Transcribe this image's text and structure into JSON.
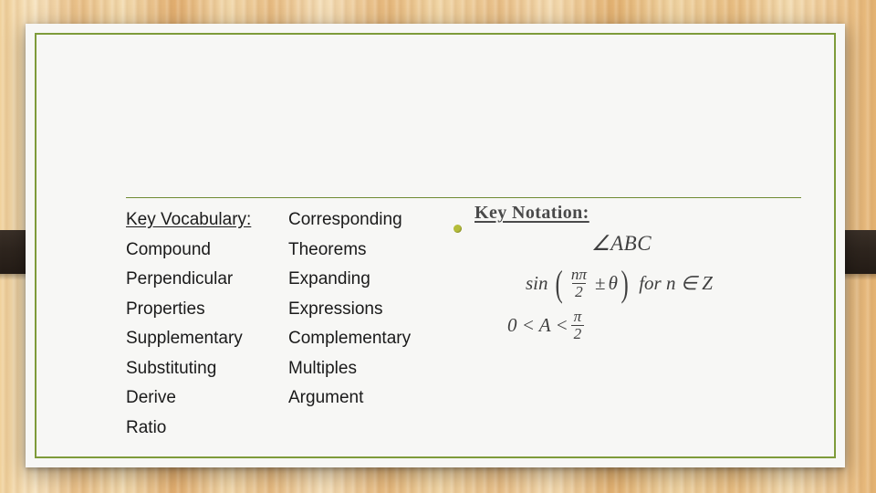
{
  "slide": {
    "divider": "horizontal-rule",
    "vocabulary": {
      "heading": "Key Vocabulary:",
      "rows": [
        {
          "a": "Key Vocabulary:",
          "b": "Corresponding"
        },
        {
          "a": "Compound",
          "b": "Theorems"
        },
        {
          "a": "Perpendicular",
          "b": "Expanding"
        },
        {
          "a": "Properties",
          "b": "Expressions"
        },
        {
          "a": "Supplementary",
          "b": "Complementary"
        },
        {
          "a": "Substituting",
          "b": "Multiples"
        },
        {
          "a": "Derive",
          "b": "Argument"
        },
        {
          "a": "Ratio",
          "b": ""
        }
      ]
    },
    "notation": {
      "title": "Key Notation:",
      "bullet_color": "#b5bd3a",
      "line_angle": "∠ABC",
      "line_sin": {
        "func": "sin",
        "open": "(",
        "numerator": "nπ",
        "denominator": "2",
        "operator": "±",
        "theta": "θ",
        "close": ")",
        "condition": "for n ∈ Z"
      },
      "line_inequality": {
        "left": "0 < A <",
        "numerator": "π",
        "denominator": "2"
      }
    }
  },
  "theme": {
    "slide_background": "#f7f7f5",
    "border_color": "#7e9b3a",
    "rule_color": "#6f8b33",
    "text_color": "#1a1a1a"
  }
}
